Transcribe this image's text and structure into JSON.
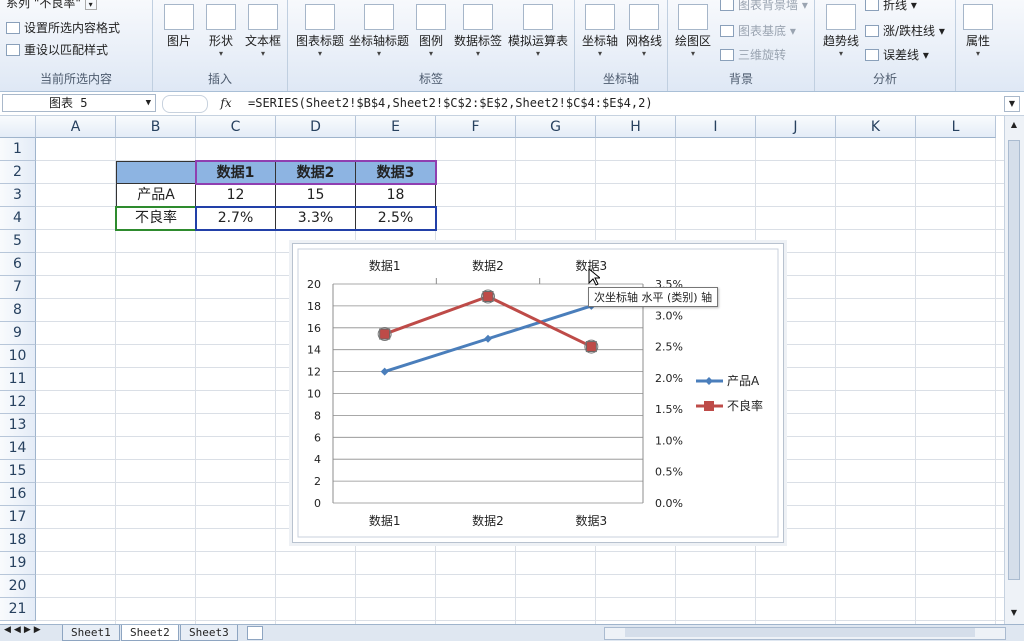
{
  "ribbon": {
    "current_selection": {
      "series_label": "系列 \"不良率\"",
      "format_selection": "设置所选内容格式",
      "reset_style": "重设以匹配样式",
      "title": "当前所选内容"
    },
    "insert": {
      "title": "插入",
      "buttons": [
        "图片",
        "形状",
        "文本框"
      ]
    },
    "labels": {
      "title": "标签",
      "buttons": [
        "图表标题",
        "坐标轴标题",
        "图例",
        "数据标签",
        "模拟运算表"
      ]
    },
    "axes": {
      "title": "坐标轴",
      "buttons": [
        "坐标轴",
        "网格线"
      ]
    },
    "background": {
      "title": "背景",
      "button": "绘图区",
      "items": [
        "图表背景墙",
        "图表基底",
        "三维旋转"
      ]
    },
    "analysis": {
      "title": "分析",
      "button": "趋势线",
      "items": [
        "折线",
        "涨/跌柱线",
        "误差线"
      ]
    },
    "properties": {
      "button": "属性"
    }
  },
  "formula_bar": {
    "name_box": "图表 5",
    "fx": "fx",
    "formula": "=SERIES(Sheet2!$B$4,Sheet2!$C$2:$E$2,Sheet2!$C$4:$E$4,2)"
  },
  "grid": {
    "columns": [
      "A",
      "B",
      "C",
      "D",
      "E",
      "F",
      "G",
      "H",
      "I",
      "J",
      "K",
      "L"
    ],
    "rows": [
      "1",
      "2",
      "3",
      "4",
      "5",
      "6",
      "7",
      "8",
      "9",
      "10",
      "11",
      "12",
      "13",
      "14",
      "15",
      "16",
      "17",
      "18",
      "19",
      "20",
      "21"
    ]
  },
  "table": {
    "headers": [
      "数据1",
      "数据2",
      "数据3"
    ],
    "rows": [
      {
        "label": "产品A",
        "values": [
          "12",
          "15",
          "18"
        ]
      },
      {
        "label": "不良率",
        "values": [
          "2.7%",
          "3.3%",
          "2.5%"
        ]
      }
    ]
  },
  "tooltip": "次坐标轴 水平 (类别) 轴",
  "sheet_tabs": [
    "Sheet1",
    "Sheet2",
    "Sheet3"
  ],
  "active_sheet": "Sheet2",
  "chart_data": {
    "type": "line",
    "categories": [
      "数据1",
      "数据2",
      "数据3"
    ],
    "series": [
      {
        "name": "产品A",
        "values": [
          12,
          15,
          18
        ],
        "axis": "primary",
        "color": "#4a7ebb"
      },
      {
        "name": "不良率",
        "values": [
          2.7,
          3.3,
          2.5
        ],
        "axis": "secondary",
        "color": "#be4b48"
      }
    ],
    "y_primary": {
      "min": 0,
      "max": 20,
      "ticks": [
        "0",
        "2",
        "4",
        "6",
        "8",
        "10",
        "12",
        "14",
        "16",
        "18",
        "20"
      ]
    },
    "y_secondary": {
      "min": 0,
      "max": 3.5,
      "ticks": [
        "0.0%",
        "0.5%",
        "1.0%",
        "1.5%",
        "2.0%",
        "2.5%",
        "3.0%",
        "3.5%"
      ]
    },
    "legend_position": "right",
    "grid": true
  }
}
